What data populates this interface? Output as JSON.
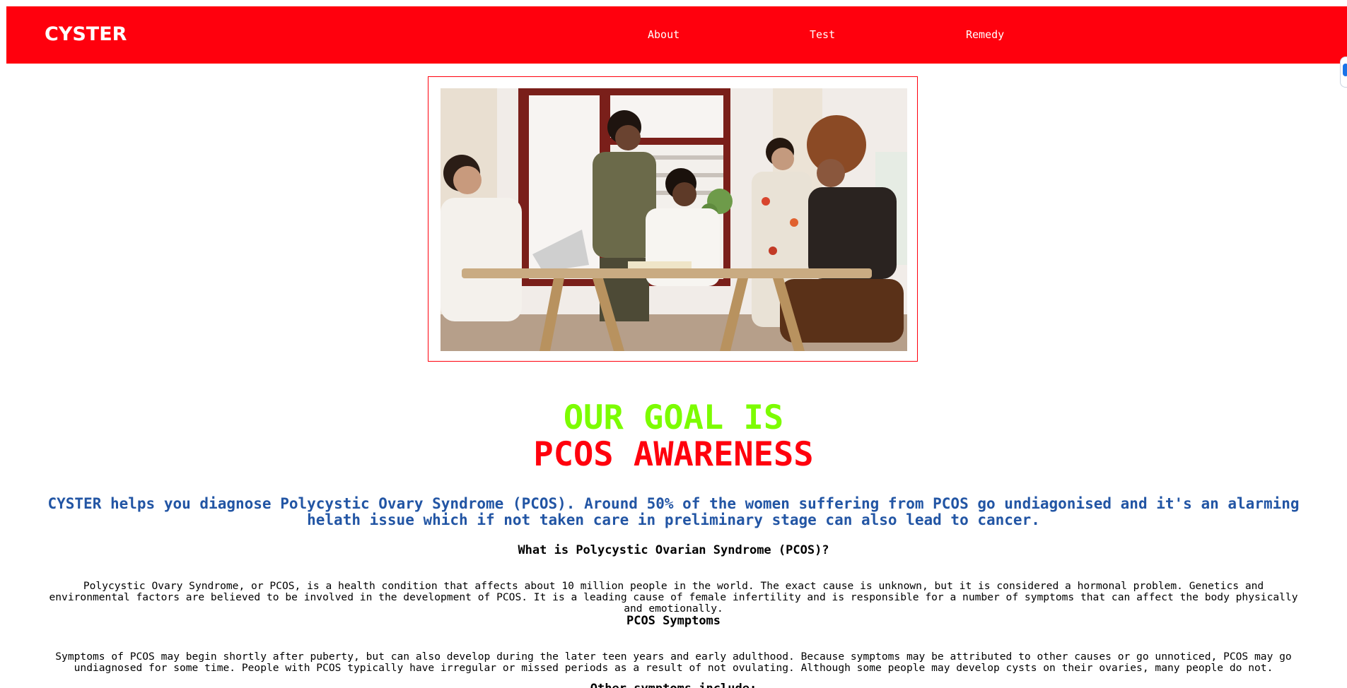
{
  "navbar": {
    "brand": "CYSTER",
    "links": [
      {
        "label": "About"
      },
      {
        "label": "Test"
      },
      {
        "label": "Remedy"
      }
    ],
    "background_color": "#ff000d"
  },
  "hero": {
    "image_icon": "photo-women-meeting-around-table"
  },
  "goal": {
    "line1": "OUR GOAL IS",
    "line2": "PCOS AWARENESS",
    "line1_color": "#7cfc00",
    "line2_color": "#ff000d"
  },
  "intro": {
    "text": "CYSTER helps you diagnose Polycystic Ovary Syndrome (PCOS). Around 50% of the women suffering from PCOS go undiagonised and it's an alarming helath issue which if not taken care in preliminary stage can also lead to cancer.",
    "color": "#2255a4"
  },
  "sections": [
    {
      "title": "What is Polycystic Ovarian Syndrome (PCOS)?",
      "body": "Polycystic Ovary Syndrome, or PCOS, is a health condition that affects about 10 million people in the world. The exact cause is unknown, but it is considered a hormonal problem. Genetics and environmental factors are believed to be involved in the development of PCOS. It is a leading cause of female infertility and is responsible for a number of symptoms that can affect the body physically and emotionally."
    },
    {
      "title": "PCOS Symptoms",
      "body": "Symptoms of PCOS may begin shortly after puberty, but can also develop during the later teen years and early adulthood. Because symptoms may be attributed to other causes or go unnoticed, PCOS may go undiagnosed for some time. People with PCOS typically have irregular or missed periods as a result of not ovulating. Although some people may develop cysts on their ovaries, many people do not."
    },
    {
      "title": "Other symptoms include:"
    }
  ]
}
